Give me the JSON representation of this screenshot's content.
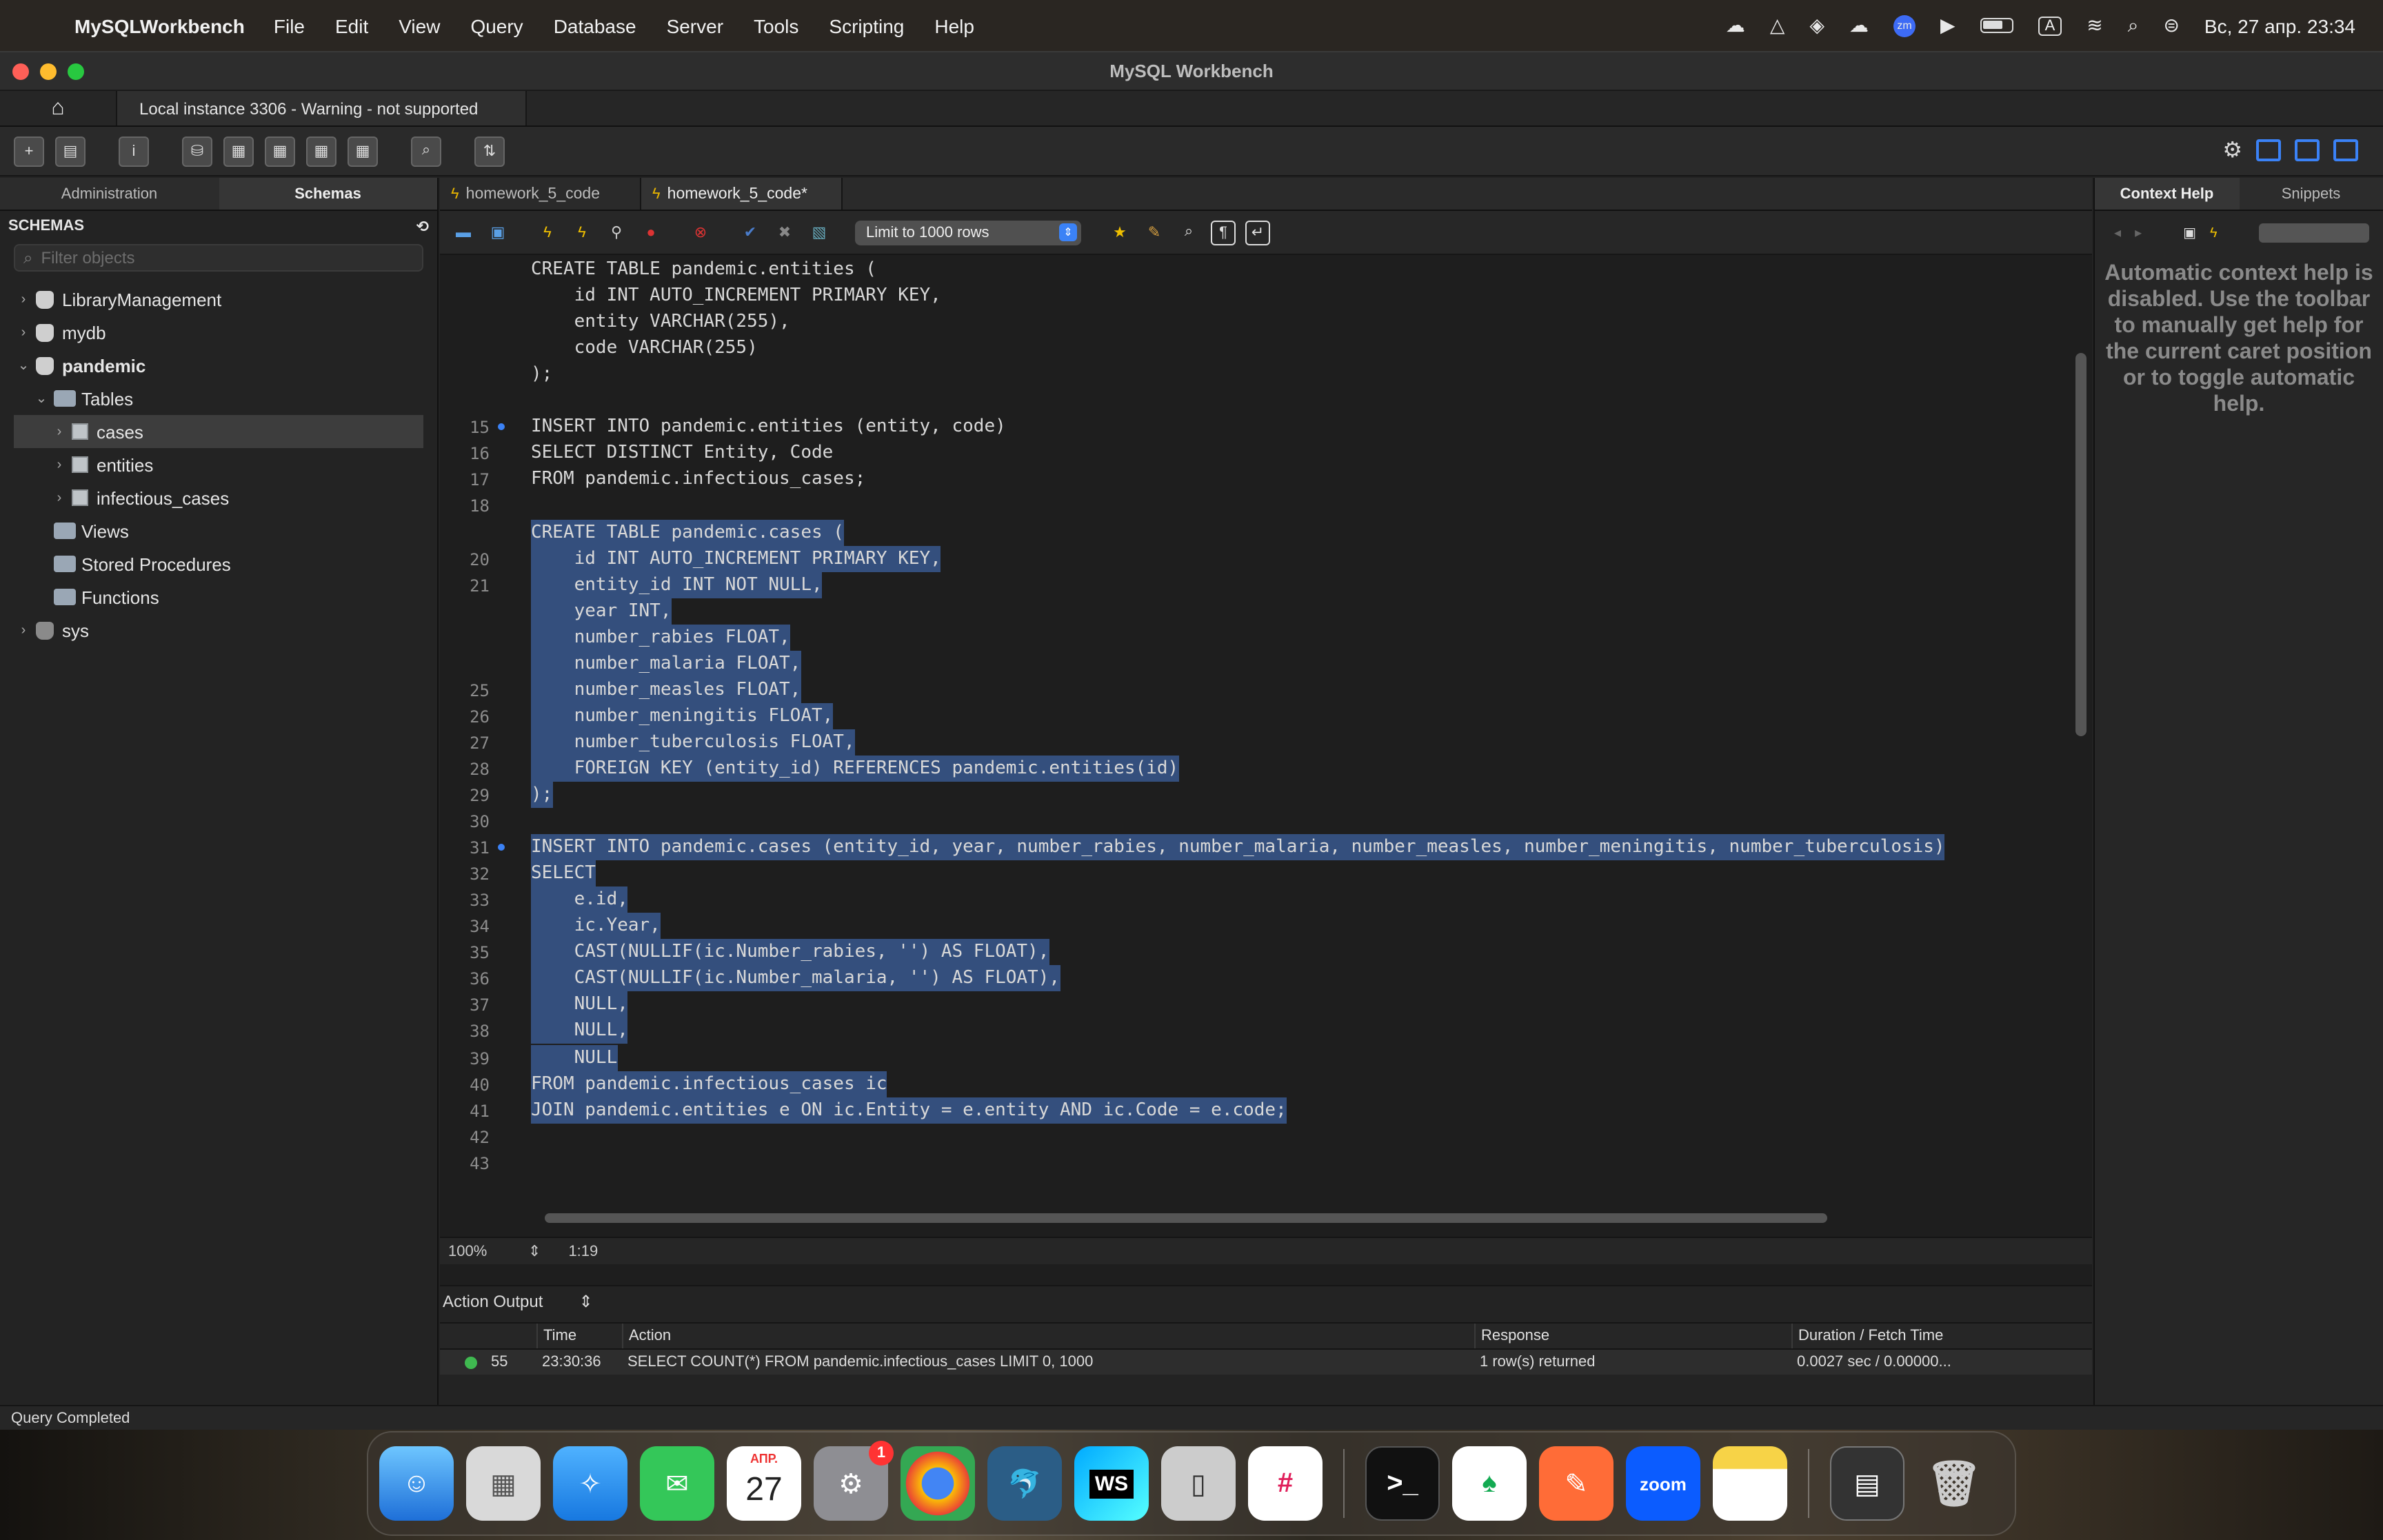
{
  "menubar": {
    "app_name": "MySQLWorkbench",
    "items": [
      "File",
      "Edit",
      "View",
      "Query",
      "Database",
      "Server",
      "Tools",
      "Scripting",
      "Help"
    ],
    "clock": "Вс, 27 апр.  23:34",
    "input_source": "A"
  },
  "window": {
    "title": "MySQL Workbench",
    "connection_tab": "Local instance 3306 - Warning - not supported"
  },
  "sidebar": {
    "tabs": [
      "Administration",
      "Schemas"
    ],
    "active_tab": "Schemas",
    "header": "SCHEMAS",
    "filter_placeholder": "Filter objects",
    "tree": {
      "db1": "LibraryManagement",
      "db2": "mydb",
      "db3": "pandemic",
      "tables": "Tables",
      "t1": "cases",
      "t2": "entities",
      "t3": "infectious_cases",
      "views": "Views",
      "procs": "Stored Procedures",
      "funcs": "Functions",
      "db4": "sys"
    }
  },
  "query_tabs": [
    "homework_5_code",
    "homework_5_code*"
  ],
  "query_toolbar": {
    "limit": "Limit to 1000 rows"
  },
  "editor": {
    "zoom": "100%",
    "cursor": "1:19",
    "lines": [
      {
        "n": "",
        "text": "CREATE TABLE pandemic.entities (",
        "sel": false
      },
      {
        "n": "",
        "text": "    id INT AUTO_INCREMENT PRIMARY KEY,",
        "sel": false
      },
      {
        "n": "",
        "text": "    entity VARCHAR(255),",
        "sel": false
      },
      {
        "n": "",
        "text": "    code VARCHAR(255)",
        "sel": false
      },
      {
        "n": "",
        "text": ");",
        "sel": false
      },
      {
        "n": "",
        "text": "",
        "sel": false
      },
      {
        "n": "15",
        "text": "INSERT INTO pandemic.entities (entity, code)",
        "sel": false,
        "mark": true
      },
      {
        "n": "16",
        "text": "SELECT DISTINCT Entity, Code",
        "sel": false
      },
      {
        "n": "17",
        "text": "FROM pandemic.infectious_cases;",
        "sel": false
      },
      {
        "n": "18",
        "text": "",
        "sel": false
      },
      {
        "n": "",
        "text": "CREATE TABLE pandemic.cases (",
        "sel": true
      },
      {
        "n": "20",
        "text": "    id INT AUTO_INCREMENT PRIMARY KEY,",
        "sel": true
      },
      {
        "n": "21",
        "text": "    entity_id INT NOT NULL,",
        "sel": true
      },
      {
        "n": "",
        "text": "    year INT,",
        "sel": true
      },
      {
        "n": "",
        "text": "    number_rabies FLOAT,",
        "sel": true
      },
      {
        "n": "",
        "text": "    number_malaria FLOAT,",
        "sel": true
      },
      {
        "n": "25",
        "text": "    number_measles FLOAT,",
        "sel": true
      },
      {
        "n": "26",
        "text": "    number_meningitis FLOAT,",
        "sel": true
      },
      {
        "n": "27",
        "text": "    number_tuberculosis FLOAT,",
        "sel": true
      },
      {
        "n": "28",
        "text": "    FOREIGN KEY (entity_id) REFERENCES pandemic.entities(id)",
        "sel": true
      },
      {
        "n": "29",
        "text": ");",
        "sel": true
      },
      {
        "n": "30",
        "text": "",
        "sel": true
      },
      {
        "n": "31",
        "text": "INSERT INTO pandemic.cases (entity_id, year, number_rabies, number_malaria, number_measles, number_meningitis, number_tuberculosis)",
        "sel": true,
        "mark": true
      },
      {
        "n": "32",
        "text": "SELECT",
        "sel": true
      },
      {
        "n": "33",
        "text": "    e.id,",
        "sel": true
      },
      {
        "n": "34",
        "text": "    ic.Year,",
        "sel": true
      },
      {
        "n": "35",
        "text": "    CAST(NULLIF(ic.Number_rabies, '') AS FLOAT),",
        "sel": true
      },
      {
        "n": "36",
        "text": "    CAST(NULLIF(ic.Number_malaria, '') AS FLOAT),",
        "sel": true
      },
      {
        "n": "37",
        "text": "    NULL,",
        "sel": true
      },
      {
        "n": "38",
        "text": "    NULL,",
        "sel": true
      },
      {
        "n": "39",
        "text": "    NULL",
        "sel": true
      },
      {
        "n": "40",
        "text": "FROM pandemic.infectious_cases ic",
        "sel": true
      },
      {
        "n": "41",
        "text": "JOIN pandemic.entities e ON ic.Entity = e.entity AND ic.Code = e.code;",
        "sel": true
      },
      {
        "n": "42",
        "text": "",
        "sel": false
      },
      {
        "n": "43",
        "text": "",
        "sel": false
      }
    ]
  },
  "output": {
    "title": "Action Output",
    "columns": [
      "Time",
      "Action",
      "Response",
      "Duration / Fetch Time"
    ],
    "rows": [
      {
        "num": "55",
        "time": "23:30:36",
        "action": "SELECT COUNT(*) FROM pandemic.infectious_cases LIMIT 0, 1000",
        "response": "1 row(s) returned",
        "duration": "0.0027 sec / 0.00000..."
      }
    ]
  },
  "right_panel": {
    "tabs": [
      "Context Help",
      "Snippets"
    ],
    "help": "Automatic context help is disabled. Use the toolbar to manually get help for the current caret position or to toggle automatic help."
  },
  "status": "Query Completed",
  "dock": {
    "calendar_month": "АПР.",
    "calendar_day": "27",
    "settings_badge": "1",
    "ws_label": "WS",
    "zoom_label": "zoom"
  }
}
